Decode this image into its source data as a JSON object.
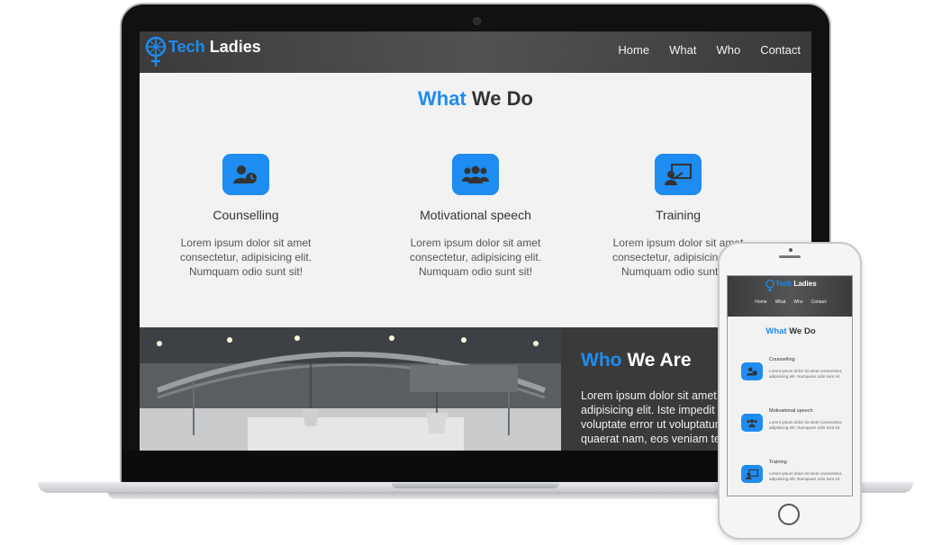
{
  "site": {
    "brand_part1": "Tech",
    "brand_part2": "Ladies",
    "nav": [
      "Home",
      "What",
      "Who",
      "Contact"
    ],
    "what_title_part1": "What",
    "what_title_part2": "We Do",
    "services": [
      {
        "name": "Counselling",
        "icon": "user-clock-icon",
        "desc": "Lorem ipsum dolor sit amet consectetur, adipisicing elit. Numquam odio sunt sit!"
      },
      {
        "name": "Motivational speech",
        "icon": "users-icon",
        "desc": "Lorem ipsum dolor sit amet consectetur, adipisicing elit. Numquam odio sunt sit!"
      },
      {
        "name": "Training",
        "icon": "chalkboard-teacher-icon",
        "desc": "Lorem ipsum dolor sit amet consectetur, adipisicing elit. Numquam odio sunt sit!"
      }
    ],
    "who_title_part1": "Who",
    "who_title_part2": "We Are",
    "who_text_lines": [
      "Lorem ipsum dolor sit amet c",
      "adipisicing elit. Iste impedit a",
      "voluptate error ut voluptatum",
      "quaerat nam, eos veniam te"
    ]
  },
  "phone_site": {
    "brand_part1": "Tech",
    "brand_part2": "Ladies",
    "nav": [
      "Home",
      "What",
      "Who",
      "Contact"
    ],
    "what_title_part1": "What",
    "what_title_part2": "We Do",
    "services": [
      {
        "name": "Counselling",
        "desc": "Lorem ipsum dolor sit amet consectetur, adipisicing elit. Numquam odio sunt sit"
      },
      {
        "name": "Motivational speech",
        "desc": "Lorem ipsum dolor sit amet consectetur, adipisicing elit. Numquam odio sunt sit"
      },
      {
        "name": "Training",
        "desc": "Lorem ipsum dolor sit amet consectetur, adipisicing elit. Numquam odio sunt sit"
      }
    ]
  },
  "colors": {
    "accent": "#1e8cf0",
    "nav_bg": "#474747",
    "page_bg": "#f2f2f2",
    "who_bg": "#3a3a3a"
  }
}
